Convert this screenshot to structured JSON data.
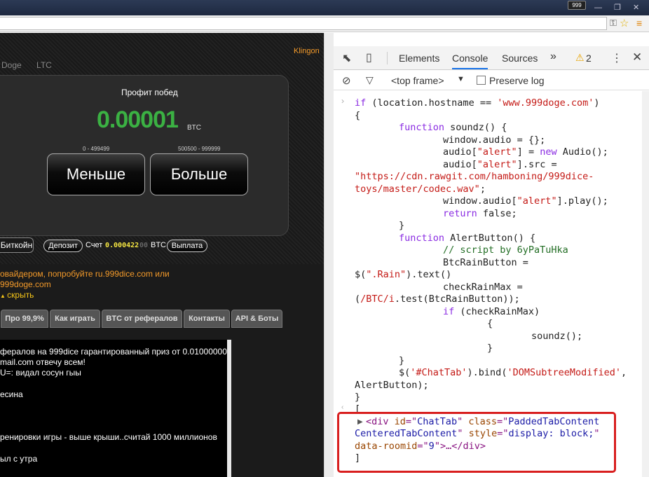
{
  "browser": {
    "extension_badge": "999",
    "window_buttons": "— ❐ ✕"
  },
  "game": {
    "user_link": "Klingon",
    "coin_tabs": [
      "Doge",
      "LTC"
    ],
    "profit_label": "Профит побед",
    "profit_value": "0.00001",
    "profit_unit": "BTC",
    "range_low": "0 - 499499",
    "range_high": "500500 - 999999",
    "lower_button": "Меньше",
    "higher_button": "Больше",
    "bitcoin_button": "Биткойн",
    "deposit_button": "Депозит",
    "balance_label": "Счет",
    "balance_value": "0.000422",
    "balance_dim": "00",
    "balance_unit": "BTC",
    "withdraw_button": "Выплата",
    "notice_line1": "овайдером, попробуйте ru.999dice.com или",
    "notice_line2": "999doge.com",
    "notice_hide": "скрыть",
    "nav_tabs": [
      "Про 99,9%",
      "Как играть",
      "BTC от рефералов",
      "Контакты",
      "API & Боты"
    ],
    "chat_lines": [
      "фералов на 999dice гарантированный приз от 0.01000000",
      "mail.com отвечу всем!",
      "U=: видал сосун гыы",
      "",
      "есина",
      "",
      "",
      "",
      "ренировки игры - выше крыши..считай 1000 миллионов",
      "",
      "ыл с утра"
    ]
  },
  "devtools": {
    "tabs": [
      "Elements",
      "Console",
      "Sources"
    ],
    "more_tabs": "»",
    "warning_count": "2",
    "frame_selector": "<top frame>",
    "preserve_log_label": "Preserve log",
    "code": {
      "l1_kw": "if",
      "l1_a": " (location.hostname == ",
      "l1_str": "'www.999doge.com'",
      "l1_b": ")",
      "l2": "{",
      "l3_kw": "function",
      "l3_b": " soundz() {",
      "l4": "window.audio = {};",
      "l5_a": "audio[",
      "l5_str": "\"alert\"",
      "l5_b": "] = ",
      "l5_kw": "new",
      "l5_c": " Audio();",
      "l6_a": "audio[",
      "l6_str": "\"alert\"",
      "l6_b": "].src =",
      "l7": "\"https://cdn.rawgit.com/hamboning/999dice-",
      "l8": "toys/master/codec.wav\"",
      "l8_b": ";",
      "l9_a": "window.audio[",
      "l9_str": "\"alert\"",
      "l9_b": "].play();",
      "l10_kw": "return",
      "l10_b": " false;",
      "l11": "}",
      "l12_kw": "function",
      "l12_b": " AlertButton() {",
      "l13": "// script by 6yPaTuHka",
      "l14": "BtcRainButton =",
      "l15_a": "$(",
      "l15_str": "\".Rain\"",
      "l15_b": ").text()",
      "l16": "checkRainMax =",
      "l17_a": "(",
      "l17_str": "/BTC/i",
      "l17_b": ".test(BtcRainButton));",
      "l18_kw": "if",
      "l18_b": " (checkRainMax)",
      "l19": "{",
      "l20": "soundz();",
      "l21": "}",
      "l22": "}",
      "l23_a": "$(",
      "l23_str": "'#ChatTab'",
      "l23_b": ").bind(",
      "l23_str2": "'DOMSubtreeModified'",
      "l23_c": ",",
      "l24": "AlertButton);",
      "l25": "}",
      "r1": "[",
      "r2_tag": "<div ",
      "r2_an1": "id",
      "r2_eq1": "=\"",
      "r2_av1": "ChatTab",
      "r2_q1": "\" ",
      "r2_an2": "class",
      "r2_eq2": "=\"",
      "r2_av2": "PaddedTabContent",
      "r3_av2": "CenteredTabContent",
      "r3_q": "\" ",
      "r3_an3": "style",
      "r3_eq3": "=\"",
      "r3_av3": "display: block;",
      "r3_q2": "\"",
      "r4_an4": "data-roomid",
      "r4_eq4": "=\"",
      "r4_av4": "9",
      "r4_q": "\"",
      "r4_tag": ">…</div>",
      "r5": "]"
    }
  }
}
